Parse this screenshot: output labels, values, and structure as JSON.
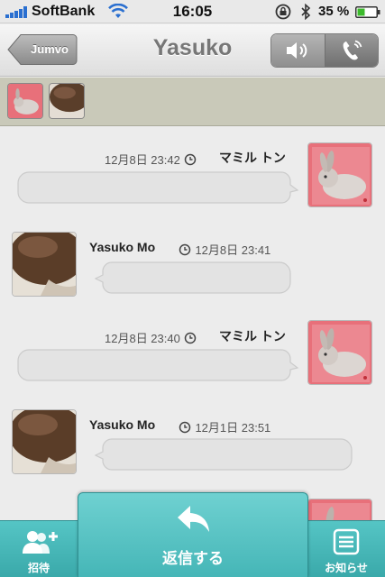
{
  "status_bar": {
    "carrier": "SoftBank",
    "time": "16:05",
    "battery": "35 %"
  },
  "nav": {
    "back_label": "Jumvo",
    "title": "Yasuko",
    "speaker_icon": "speaker-icon",
    "phone_icon": "phone-icon"
  },
  "avatar_strip": [
    {
      "icon": "rabbit-avatar"
    },
    {
      "icon": "hair-avatar"
    }
  ],
  "messages": [
    {
      "side": "right",
      "name": "マミル トン",
      "time": "12月8日 23:42",
      "avatar": "rabbit-avatar"
    },
    {
      "side": "left",
      "name": "Yasuko Mo",
      "time": "12月8日 23:41",
      "avatar": "hair-avatar"
    },
    {
      "side": "right",
      "name": "マミル トン",
      "time": "12月8日 23:40",
      "avatar": "rabbit-avatar"
    },
    {
      "side": "left",
      "name": "Yasuko Mo",
      "time": "12月1日 23:51",
      "avatar": "hair-avatar"
    }
  ],
  "tabbar": {
    "invite_label": "招待",
    "reply_label": "返信する",
    "notice_label": "お知らせ"
  },
  "colors": {
    "accent": "#45b6b7",
    "rabbit_bg": "#e8707a"
  }
}
